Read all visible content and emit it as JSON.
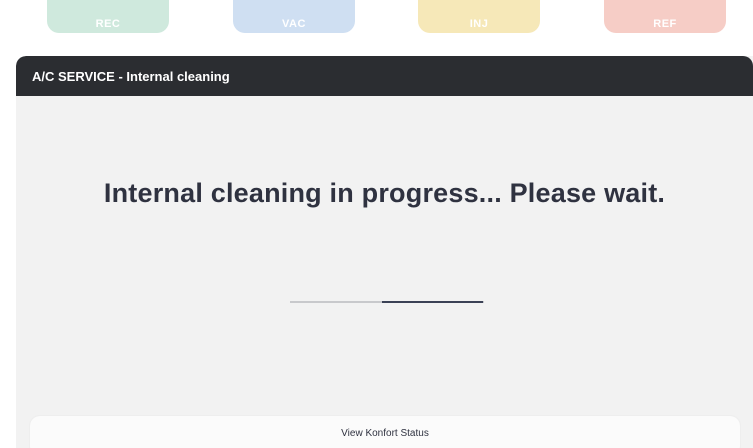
{
  "mode_tabs": [
    {
      "label": "REC",
      "color": "#cfe9dd"
    },
    {
      "label": "VAC",
      "color": "#cfdff2"
    },
    {
      "label": "INJ",
      "color": "#f6e8b8"
    },
    {
      "label": "REF",
      "color": "#f6cdc6"
    }
  ],
  "panel": {
    "title": "A/C SERVICE - Internal cleaning",
    "status_message": "Internal cleaning in progress... Please wait.",
    "progress": {
      "fraction": 0.52,
      "track_color": "#c8c9cc",
      "fill_color": "#3b4256"
    },
    "footer_button_label": "View Konfort Status"
  },
  "colors": {
    "header_bg": "#2b2d31",
    "panel_bg": "#f2f2f2",
    "text_dark": "#2f3240"
  }
}
